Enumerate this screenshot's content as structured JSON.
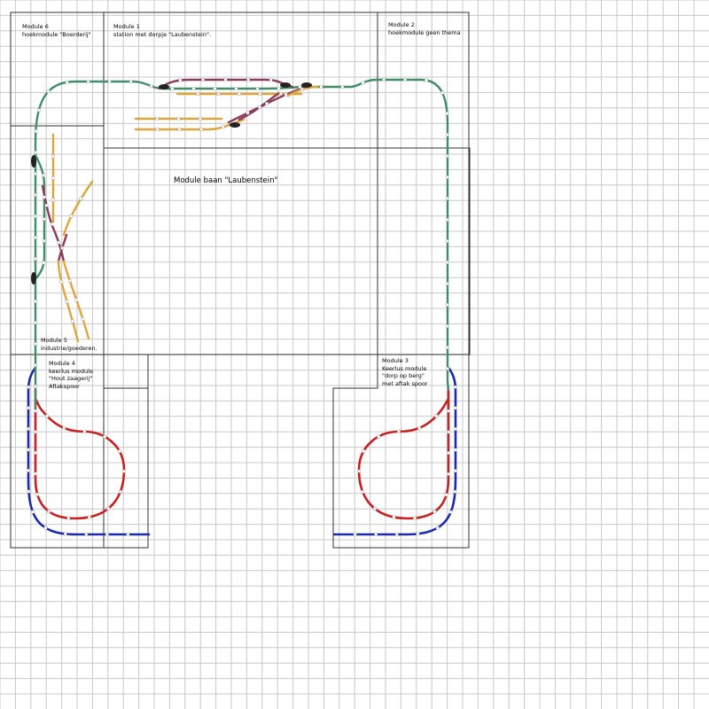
{
  "title": "Module baan \"Laubenstein\"",
  "modules": [
    {
      "id": "m6",
      "name": "Module 6",
      "desc": "hoekmodule \"Boerderij\""
    },
    {
      "id": "m1",
      "name": "Module 1",
      "desc": "station met dorpje \"Laubenstein\"."
    },
    {
      "id": "m2",
      "name": "Module 2",
      "desc": "hoekmodule geen thema"
    },
    {
      "id": "m5",
      "name": "Module 5",
      "desc": "industrie/goederen."
    },
    {
      "id": "m4",
      "name": "Module 4",
      "desc": "keerlus module\n\"Hout zaagerij\"\nAftakspoor"
    },
    {
      "id": "m3",
      "name": "Module 3",
      "desc": "Keerlus module\n\"dorp op berg\"\nmet aftak spoor"
    }
  ],
  "colors": {
    "grid": "#c8c8c8",
    "outline": "#333333",
    "mainline": "#3e8e68",
    "siding": "#e0a53a",
    "turnout": "#8b3a5c",
    "loop_inner": "#c82020",
    "loop_outer": "#1a2aa8",
    "joint": "#ffffff"
  },
  "icons": {
    "joint": "track-joint-marker",
    "switch": "turnout-motor-marker"
  }
}
